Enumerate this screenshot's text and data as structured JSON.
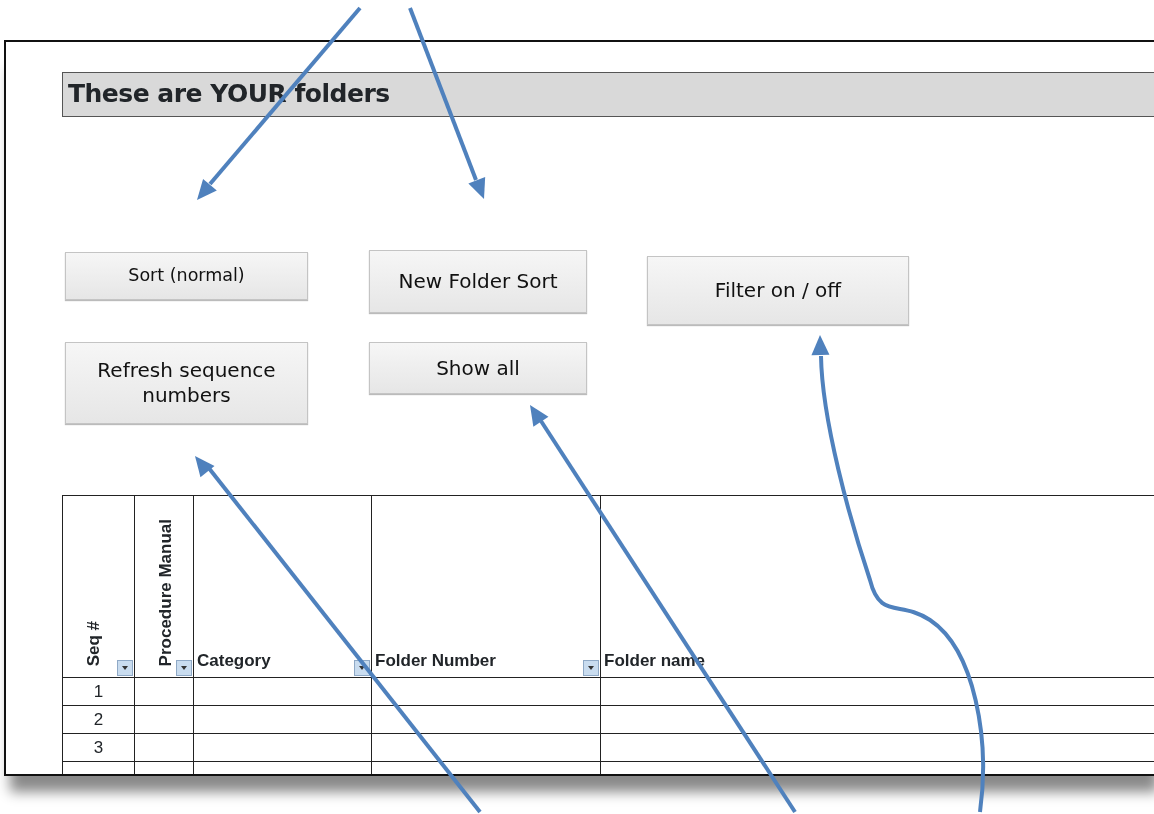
{
  "sheet_title": "These are YOUR folders",
  "buttons": [
    {
      "label": "Sort (normal)"
    },
    {
      "label": "New Folder Sort"
    },
    {
      "label": "Filter on / off"
    },
    {
      "label": "Refresh sequence numbers"
    },
    {
      "label": "Show all"
    }
  ],
  "table": {
    "columns": [
      {
        "label": "Seq #",
        "vertical": true,
        "filter": true
      },
      {
        "label": "Procedure Manual",
        "vertical": true,
        "filter": true
      },
      {
        "label": "Category",
        "vertical": false,
        "filter": true
      },
      {
        "label": "Folder Number",
        "vertical": false,
        "filter": true
      },
      {
        "label": "Folder name",
        "vertical": false,
        "filter": false
      }
    ],
    "rows": [
      [
        "1",
        "",
        "",
        "",
        ""
      ],
      [
        "2",
        "",
        "",
        "",
        ""
      ],
      [
        "3",
        "",
        "",
        "",
        ""
      ]
    ]
  }
}
